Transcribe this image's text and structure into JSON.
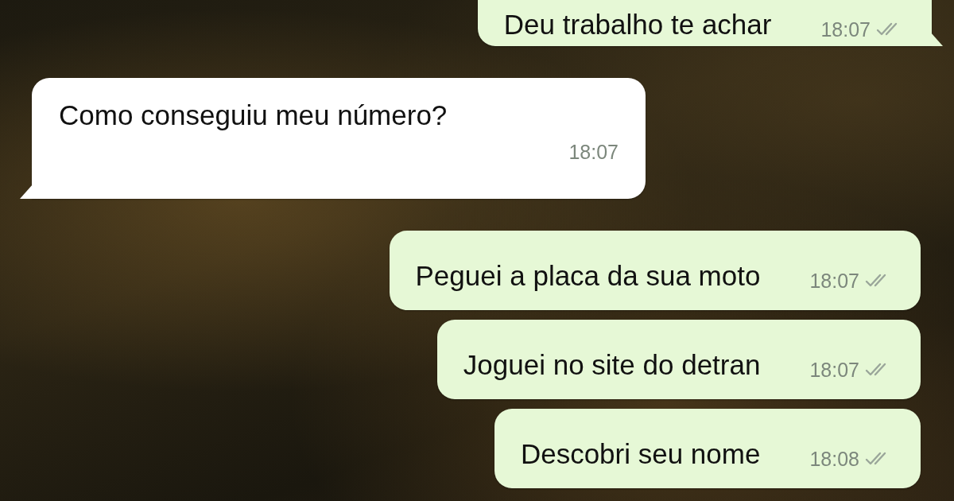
{
  "messages": [
    {
      "kind": "sent",
      "text": "Deu trabalho te achar",
      "time": "18:07",
      "tail": true
    },
    {
      "kind": "received",
      "text": "Como conseguiu meu número?",
      "time": "18:07",
      "tail": true
    },
    {
      "kind": "sent",
      "text": "Peguei a placa da sua moto",
      "time": "18:07",
      "tail": false
    },
    {
      "kind": "sent",
      "text": "Joguei no site do detran",
      "time": "18:07",
      "tail": false
    },
    {
      "kind": "sent",
      "text": "Descobri seu nome",
      "time": "18:08",
      "tail": false
    }
  ]
}
